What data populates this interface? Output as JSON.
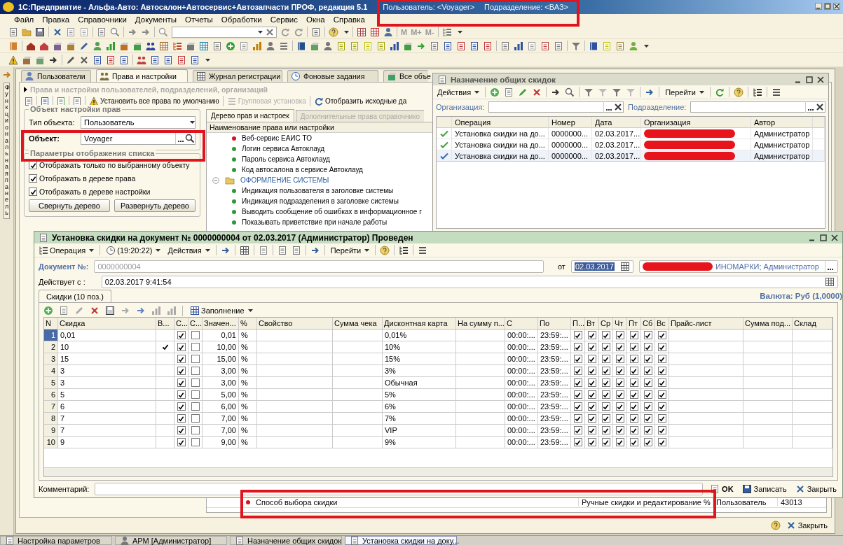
{
  "window": {
    "title": "1С:Предприятие - Альфа-Авто: Автосалон+Автосервис+Автозапчасти ПРОФ, редакция 5.1",
    "user": "Пользователь: <Voyager>",
    "division": "Подразделение: <ВАЗ>"
  },
  "menu": [
    "Файл",
    "Правка",
    "Справочники",
    "Документы",
    "Отчеты",
    "Обработки",
    "Сервис",
    "Окна",
    "Справка"
  ],
  "toolbar": {
    "memory_buttons": [
      "M",
      "M+",
      "M-"
    ]
  },
  "function_panel": {
    "label": "Функциональная панель"
  },
  "main_window": {
    "tabs": [
      {
        "label": "Пользователи",
        "selected": false
      },
      {
        "label": "Права и настройки",
        "selected": true
      },
      {
        "label": "Журнал регистрации",
        "selected": false
      },
      {
        "label": "Фоновые задания",
        "selected": false
      },
      {
        "label": "Все объе",
        "selected": false
      }
    ],
    "header": "Права и настройки пользователей, подразделений, организаций",
    "actions": [
      {
        "label": "Установить все права по умолчанию",
        "disabled": false
      },
      {
        "label": "Групповая установка",
        "disabled": true
      },
      {
        "label": "Отобразить исходные да",
        "disabled": false
      }
    ],
    "object_group": {
      "title": "Объект настройки прав",
      "type_label": "Тип объекта:",
      "type_value": "Пользователь",
      "object_label": "Объект:",
      "object_value": "Voyager"
    },
    "display_group": {
      "title": "Параметры отображения списка",
      "options": [
        {
          "label": "Отображать только по  выбранному объекту",
          "checked": true
        },
        {
          "label": "Отображать в дереве права",
          "checked": true
        },
        {
          "label": "Отображать в дереве настройки",
          "checked": true
        }
      ],
      "buttons": [
        "Свернуть дерево",
        "Развернуть дерево"
      ]
    },
    "tree_tabs": [
      {
        "label": "Дерево прав и настроек",
        "selected": true
      },
      {
        "label": "Дополнительные права справочнико",
        "selected": false
      }
    ],
    "tree_header": "Наименование права или настройки",
    "tree": [
      {
        "kind": "setting",
        "label": "Веб-сервис ЕАИС ТО",
        "color": "#d01818"
      },
      {
        "kind": "setting",
        "label": "Логин сервиса Автоклауд",
        "color": "#2a9a3a"
      },
      {
        "kind": "setting",
        "label": "Пароль сервиса Автоклауд",
        "color": "#2a9a3a"
      },
      {
        "kind": "setting",
        "label": "Код автосалона в сервисе Автоклауд",
        "color": "#2a9a3a"
      },
      {
        "kind": "folder",
        "label": "ОФОРМЛЕНИЕ СИСТЕМЫ",
        "expanded": true,
        "children": [
          {
            "kind": "setting",
            "label": "Индикация пользователя в заголовке системы",
            "color": "#2a9a3a"
          },
          {
            "kind": "setting",
            "label": "Индикация подразделения в заголовке системы",
            "color": "#2a9a3a"
          },
          {
            "kind": "setting",
            "label": "Выводить сообщение об ошибках в информационное г",
            "color": "#2a9a3a"
          },
          {
            "kind": "setting",
            "label": "Показывать приветствие при начале работы",
            "color": "#2a9a3a"
          }
        ]
      }
    ],
    "tree_bottom_row": {
      "label": "Способ выбора скидки",
      "color": "#d01818",
      "value": "Ручные скидки и редактирование %",
      "scope": "Пользователь",
      "code": "43013"
    },
    "footer_button": "Закрыть"
  },
  "discounts_list": {
    "title": "Назначение общих скидок",
    "actions": "Действия",
    "goto": "Перейти",
    "filters": [
      {
        "label": "Организация:"
      },
      {
        "label": "Подразделение:"
      }
    ],
    "columns": [
      "Операция",
      "Номер",
      "Дата",
      "Организация",
      "Автор"
    ],
    "rows": [
      {
        "operation": "Установка скидки на до...",
        "number": "0000000...",
        "date": "02.03.2017...",
        "author": "Администратор",
        "selected": false
      },
      {
        "operation": "Установка скидки на до...",
        "number": "0000000...",
        "date": "02.03.2017...",
        "author": "Администратор",
        "selected": false
      },
      {
        "operation": "Установка скидки на до...",
        "number": "0000000...",
        "date": "02.03.2017...",
        "author": "Администратор",
        "selected": true
      }
    ]
  },
  "document": {
    "title": "Установка скидки на документ № 0000000004 от 02.03.2017 (Администратор) Проведен",
    "toolbar": {
      "operation": "Операция",
      "time": "(19:20:22)",
      "actions": "Действия",
      "goto": "Перейти"
    },
    "number_label": "Документ №:",
    "number": "0000000004",
    "date_label": "от",
    "date": "02.03.2017",
    "org_tail": "ИНОМАРКИ; Администратор",
    "valid_label": "Действует с :",
    "valid_from": "02.03.2017  9:41:54",
    "currency": "Валюта: Руб (1,0000)",
    "tab": "Скидки (10 поз.)",
    "fill_button": "Заполнение",
    "columns": [
      "N",
      "Скидка",
      "В...",
      "С...",
      "С...",
      "Значен...",
      "%",
      "Свойство",
      "Сумма чека",
      "Дисконтная карта",
      "На сумму п...",
      "С",
      "По",
      "П...",
      "Вт",
      "Ср",
      "Чт",
      "Пт",
      "Сб",
      "Вс",
      "Прайс-лист",
      "Сумма под...",
      "Склад"
    ],
    "rows": [
      {
        "n": "1",
        "discount": "0,01",
        "flag_b": false,
        "flag_c1": true,
        "flag_c2": false,
        "value": "0,01",
        "unit": "%",
        "card": "0,01%",
        "from": "00:00:...",
        "to": "23:59:...",
        "days": [
          true,
          true,
          true,
          true,
          true,
          true,
          true
        ],
        "selected": true
      },
      {
        "n": "2",
        "discount": "10",
        "flag_b": true,
        "flag_c1": true,
        "flag_c2": false,
        "value": "10,00",
        "unit": "%",
        "card": "10%",
        "from": "00:00:...",
        "to": "23:59:...",
        "days": [
          true,
          true,
          true,
          true,
          true,
          true,
          true
        ],
        "selected": false
      },
      {
        "n": "3",
        "discount": "15",
        "flag_b": false,
        "flag_c1": true,
        "flag_c2": false,
        "value": "15,00",
        "unit": "%",
        "card": "15%",
        "from": "00:00:...",
        "to": "23:59:...",
        "days": [
          true,
          true,
          true,
          true,
          true,
          true,
          true
        ],
        "selected": false
      },
      {
        "n": "4",
        "discount": "3",
        "flag_b": false,
        "flag_c1": true,
        "flag_c2": false,
        "value": "3,00",
        "unit": "%",
        "card": "3%",
        "from": "00:00:...",
        "to": "23:59:...",
        "days": [
          true,
          true,
          true,
          true,
          true,
          true,
          true
        ],
        "selected": false
      },
      {
        "n": "5",
        "discount": "3",
        "flag_b": false,
        "flag_c1": true,
        "flag_c2": false,
        "value": "3,00",
        "unit": "%",
        "card": "Обычная",
        "from": "00:00:...",
        "to": "23:59:...",
        "days": [
          true,
          true,
          true,
          true,
          true,
          true,
          true
        ],
        "selected": false
      },
      {
        "n": "6",
        "discount": "5",
        "flag_b": false,
        "flag_c1": true,
        "flag_c2": false,
        "value": "5,00",
        "unit": "%",
        "card": "5%",
        "from": "00:00:...",
        "to": "23:59:...",
        "days": [
          true,
          true,
          true,
          true,
          true,
          true,
          true
        ],
        "selected": false
      },
      {
        "n": "7",
        "discount": "6",
        "flag_b": false,
        "flag_c1": true,
        "flag_c2": false,
        "value": "6,00",
        "unit": "%",
        "card": "6%",
        "from": "00:00:...",
        "to": "23:59:...",
        "days": [
          true,
          true,
          true,
          true,
          true,
          true,
          true
        ],
        "selected": false
      },
      {
        "n": "8",
        "discount": "7",
        "flag_b": false,
        "flag_c1": true,
        "flag_c2": false,
        "value": "7,00",
        "unit": "%",
        "card": "7%",
        "from": "00:00:...",
        "to": "23:59:...",
        "days": [
          true,
          true,
          true,
          true,
          true,
          true,
          true
        ],
        "selected": false
      },
      {
        "n": "9",
        "discount": "7",
        "flag_b": false,
        "flag_c1": true,
        "flag_c2": false,
        "value": "7,00",
        "unit": "%",
        "card": "VIP",
        "from": "00:00:...",
        "to": "23:59:...",
        "days": [
          true,
          true,
          true,
          true,
          true,
          true,
          true
        ],
        "selected": false
      },
      {
        "n": "10",
        "discount": "9",
        "flag_b": false,
        "flag_c1": true,
        "flag_c2": false,
        "value": "9,00",
        "unit": "%",
        "card": "9%",
        "from": "00:00:...",
        "to": "23:59:...",
        "days": [
          true,
          true,
          true,
          true,
          true,
          true,
          true
        ],
        "selected": false
      }
    ],
    "comment_label": "Комментарий:",
    "buttons": [
      "OK",
      "Записать",
      "Закрыть"
    ]
  },
  "taskbar": [
    {
      "label": "Настройка параметров",
      "selected": false
    },
    {
      "label": "АРМ [Администратор]",
      "selected": false
    },
    {
      "label": "Назначение общих скидок",
      "selected": false
    },
    {
      "label": "Установка скидки на доку...",
      "selected": true
    }
  ]
}
